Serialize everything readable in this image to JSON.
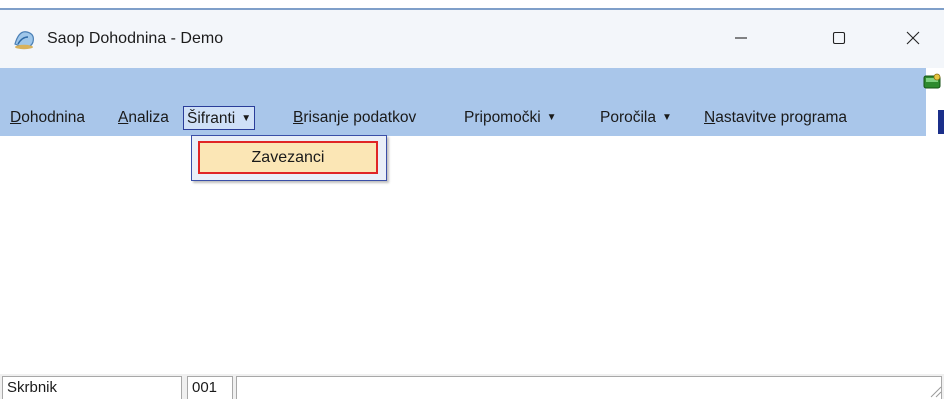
{
  "window": {
    "title": "Saop Dohodnina - Demo",
    "controls": {
      "minimize": "minimize-icon",
      "maximize": "maximize-icon",
      "close": "close-icon"
    }
  },
  "menubar": {
    "items": [
      {
        "label": "Dohodnina",
        "accel": "D",
        "rest": "ohodnina",
        "has_submenu": false
      },
      {
        "label": "Analiza",
        "accel": "A",
        "rest": "naliza",
        "has_submenu": false
      },
      {
        "label": "Šifranti",
        "accel": "",
        "rest": "Šifranti",
        "has_submenu": true,
        "open": true
      },
      {
        "label": "Brisanje podatkov",
        "accel": "B",
        "rest": "risanje podatkov",
        "has_submenu": false
      },
      {
        "label": "Pripomočki",
        "accel": "",
        "rest": "Pripomočki",
        "has_submenu": true
      },
      {
        "label": "Poročila",
        "accel": "",
        "rest": "Poročila",
        "has_submenu": true
      },
      {
        "label": "Nastavitve programa",
        "accel": "N",
        "rest": "astavitve programa",
        "has_submenu": false
      }
    ]
  },
  "dropdown": {
    "items": [
      {
        "label": "Zavezanci",
        "highlighted": true
      }
    ]
  },
  "statusbar": {
    "user": "Skrbnik",
    "company_code": "001",
    "message": ""
  },
  "colors": {
    "menubar_bg": "#a9c6ea",
    "dropdown_item_bg": "#fbe6b5",
    "highlight_border": "#e02525",
    "menu_open_border": "#2a3d9a"
  }
}
